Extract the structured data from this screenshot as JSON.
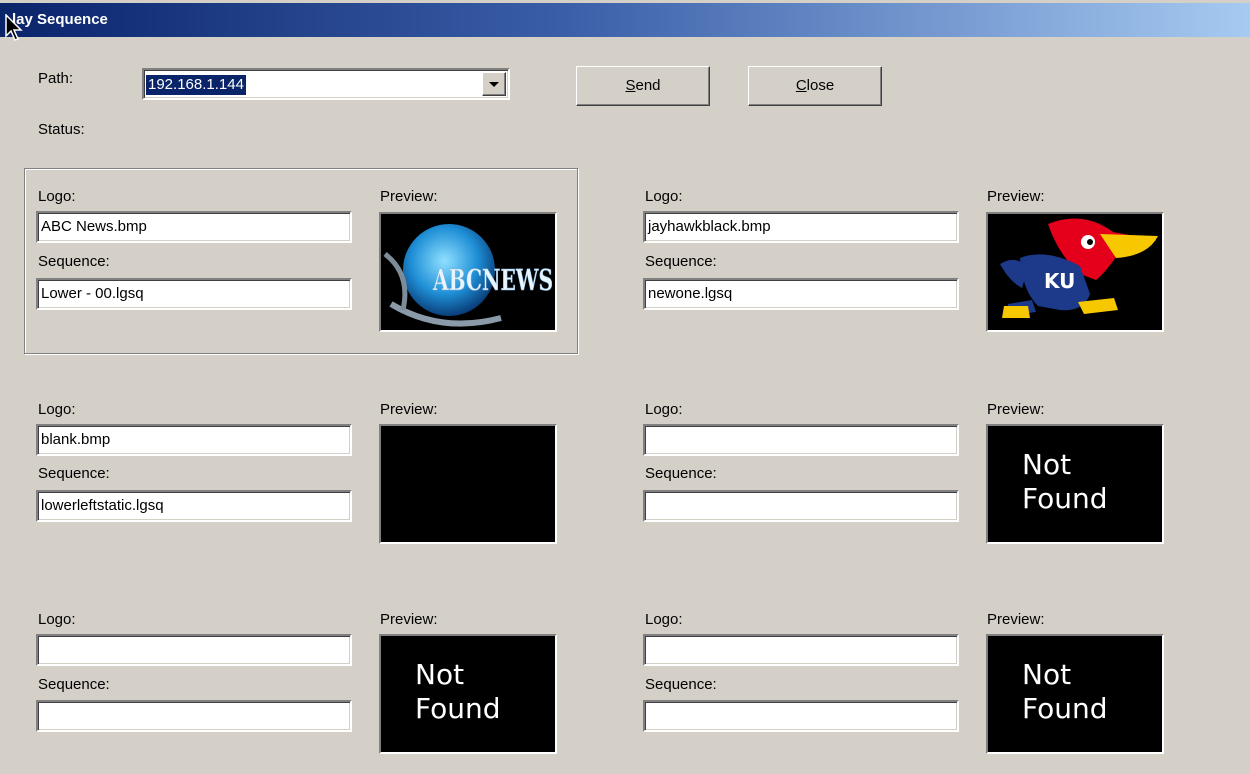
{
  "window": {
    "title": "lay Sequence"
  },
  "path": {
    "label": "Path:",
    "value": "192.168.1.144"
  },
  "status": {
    "label": "Status:"
  },
  "buttons": {
    "send": {
      "mnemonic": "S",
      "rest": "end"
    },
    "close": {
      "mnemonic": "C",
      "rest": "lose"
    }
  },
  "slots": [
    {
      "logo_label": "Logo:",
      "logo": "ABC News.bmp",
      "sequence_label": "Sequence:",
      "sequence": "Lower - 00.lgsq",
      "preview_label": "Preview:",
      "preview_text": "ABCNEWS"
    },
    {
      "logo_label": "Logo:",
      "logo": "jayhawkblack.bmp",
      "sequence_label": "Sequence:",
      "sequence": "newone.lgsq",
      "preview_label": "Preview:",
      "preview_text": "KU"
    },
    {
      "logo_label": "Logo:",
      "logo": "blank.bmp",
      "sequence_label": "Sequence:",
      "sequence": "lowerleftstatic.lgsq",
      "preview_label": "Preview:"
    },
    {
      "logo_label": "Logo:",
      "logo": "",
      "sequence_label": "Sequence:",
      "sequence": "",
      "preview_label": "Preview:",
      "preview_line1": "Not",
      "preview_line2": "Found"
    },
    {
      "logo_label": "Logo:",
      "logo": "",
      "sequence_label": "Sequence:",
      "sequence": "",
      "preview_label": "Preview:",
      "preview_line1": "Not",
      "preview_line2": "Found"
    },
    {
      "logo_label": "Logo:",
      "logo": "",
      "sequence_label": "Sequence:",
      "sequence": "",
      "preview_label": "Preview:",
      "preview_line1": "Not",
      "preview_line2": "Found"
    }
  ]
}
